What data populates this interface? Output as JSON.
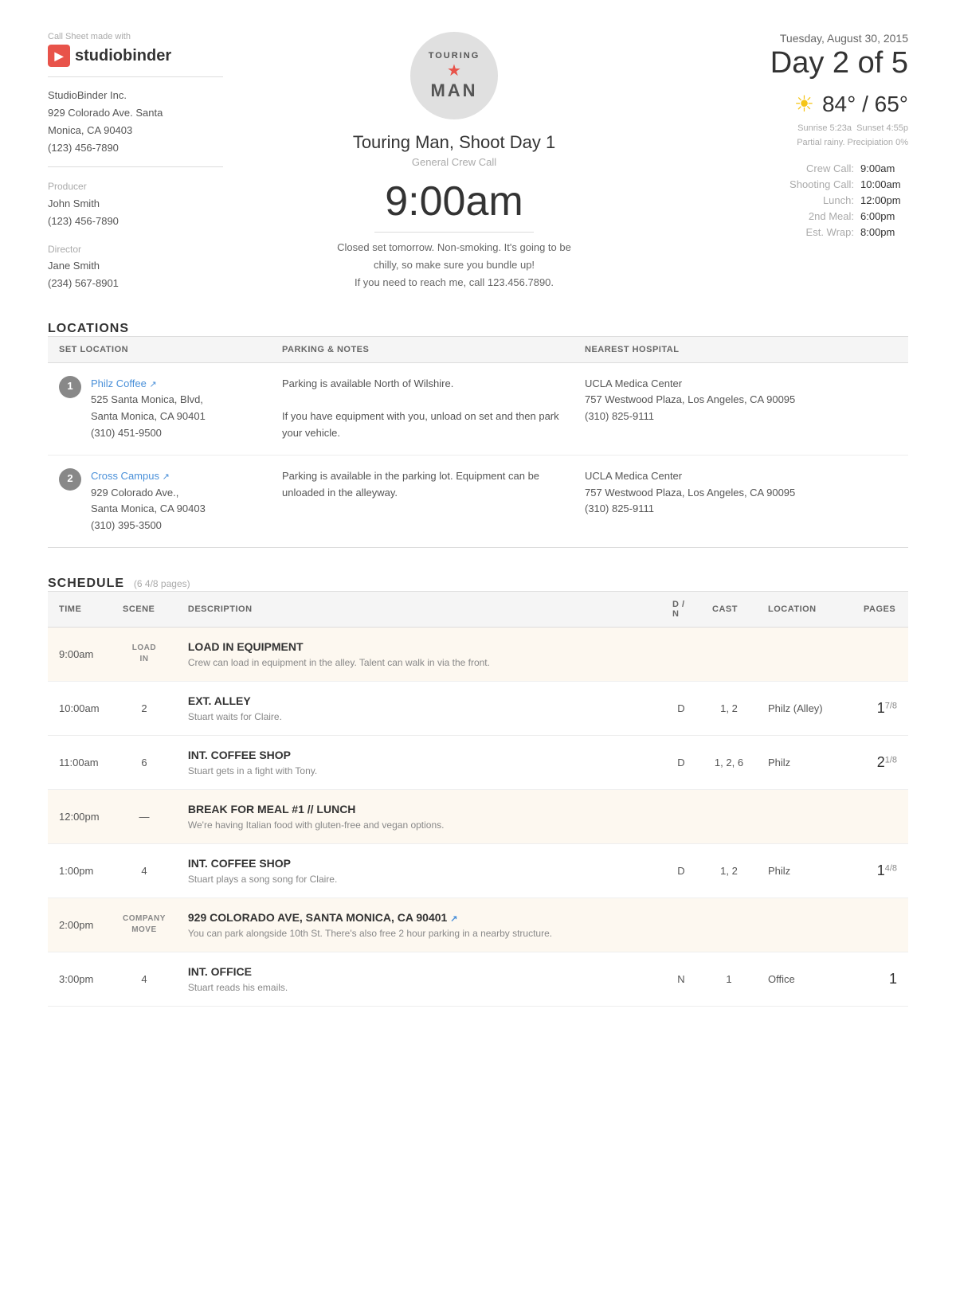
{
  "header": {
    "made_with": "Call Sheet made with",
    "logo_text": "studiobinder",
    "logo_bold": "binder",
    "company": {
      "name": "StudioBinder Inc.",
      "address1": "929 Colorado Ave. Santa",
      "address2": "Monica, CA 90403",
      "phone": "(123) 456-7890"
    },
    "producer_role": "Producer",
    "producer_name": "John Smith",
    "producer_phone": "(123) 456-7890",
    "director_role": "Director",
    "director_name": "Jane Smith",
    "director_phone": "(234) 567-8901"
  },
  "project": {
    "logo_top": "TOURING",
    "logo_star": "★",
    "logo_bottom": "MAN",
    "title": "Touring Man, Shoot Day 1",
    "subtitle": "General Crew Call",
    "time": "9:00am",
    "notes_line1": "Closed set tomorrow. Non-smoking. It's going to be",
    "notes_line2": "chilly, so make sure you bundle up!",
    "notes_line3": "If you need to reach me, call 123.456.7890."
  },
  "date": {
    "heading": "Tuesday, August 30, 2015",
    "day_label": "Day 2 of 5"
  },
  "weather": {
    "temp_high": "84°",
    "temp_low": "65°",
    "sunrise": "Sunrise 5:23a",
    "sunset": "Sunset 4:55p",
    "condition": "Partial rainy. Precipiation 0%"
  },
  "schedule_times": [
    {
      "label": "Crew Call:",
      "value": "9:00am"
    },
    {
      "label": "Shooting Call:",
      "value": "10:00am"
    },
    {
      "label": "Lunch:",
      "value": "12:00pm"
    },
    {
      "label": "2nd Meal:",
      "value": "6:00pm"
    },
    {
      "label": "Est. Wrap:",
      "value": "8:00pm"
    }
  ],
  "locations_section": {
    "title": "LOCATIONS",
    "col_set": "SET LOCATION",
    "col_parking": "PARKING & NOTES",
    "col_hospital": "NEAREST HOSPITAL",
    "rows": [
      {
        "number": "1",
        "name": "Philz Coffee",
        "address1": "525 Santa Monica, Blvd,",
        "address2": "Santa Monica, CA 90401",
        "phone": "(310) 451-9500",
        "parking": "Parking is available North of Wilshire.\n\nIf you have equipment with you, unload on set and then park your vehicle.",
        "hospital_name": "UCLA Medica Center",
        "hospital_address": "757 Westwood Plaza, Los Angeles, CA 90095",
        "hospital_phone": "(310) 825-9111"
      },
      {
        "number": "2",
        "name": "Cross Campus",
        "address1": "929 Colorado Ave.,",
        "address2": "Santa Monica, CA 90403",
        "phone": "(310) 395-3500",
        "parking": "Parking is available in the parking lot. Equipment can be unloaded in the alleyway.",
        "hospital_name": "UCLA Medica Center",
        "hospital_address": "757 Westwood Plaza, Los Angeles, CA 90095",
        "hospital_phone": "(310) 825-9111"
      }
    ]
  },
  "schedule_section": {
    "title": "SCHEDULE",
    "subtitle": "(6 4/8 pages)",
    "col_time": "TIME",
    "col_scene": "SCENE",
    "col_desc": "DESCRIPTION",
    "col_dn": "D / N",
    "col_cast": "CAST",
    "col_location": "LOCATION",
    "col_pages": "PAGES",
    "rows": [
      {
        "time": "9:00am",
        "scene": "LOAD IN",
        "scene_multiline": true,
        "desc_title": "LOAD IN EQUIPMENT",
        "desc_sub": "Crew can load in equipment in the alley. Talent can walk in via the front.",
        "dn": "",
        "cast": "",
        "location": "",
        "pages": "",
        "highlight": true,
        "colspan": true
      },
      {
        "time": "10:00am",
        "scene": "2",
        "desc_title": "EXT. ALLEY",
        "desc_sub": "Stuart waits for Claire.",
        "dn": "D",
        "cast": "1, 2",
        "location": "Philz (Alley)",
        "pages_main": "1",
        "pages_frac": "7/8",
        "highlight": false
      },
      {
        "time": "11:00am",
        "scene": "6",
        "desc_title": "INT. COFFEE SHOP",
        "desc_sub": "Stuart gets in a fight with Tony.",
        "dn": "D",
        "cast": "1, 2, 6",
        "location": "Philz",
        "pages_main": "2",
        "pages_frac": "1/8",
        "highlight": false
      },
      {
        "time": "12:00pm",
        "scene": "—",
        "desc_title": "BREAK FOR MEAL #1 // LUNCH",
        "desc_sub": "We're having Italian food with gluten-free and vegan options.",
        "dn": "",
        "cast": "",
        "location": "",
        "pages": "",
        "highlight": true,
        "colspan": true
      },
      {
        "time": "1:00pm",
        "scene": "4",
        "desc_title": "INT. COFFEE SHOP",
        "desc_sub": "Stuart plays a song song for Claire.",
        "dn": "D",
        "cast": "1, 2",
        "location": "Philz",
        "pages_main": "1",
        "pages_frac": "4/8",
        "highlight": false
      },
      {
        "time": "2:00pm",
        "scene": "COMPANY MOVE",
        "scene_multiline": true,
        "desc_title": "929 COLORADO AVE, SANTA MONICA, CA 90401",
        "desc_has_link": true,
        "desc_sub": "You can park alongside 10th St. There's also free 2 hour parking in a nearby structure.",
        "dn": "",
        "cast": "",
        "location": "",
        "pages": "",
        "highlight": true,
        "colspan": true,
        "is_move": true
      },
      {
        "time": "3:00pm",
        "scene": "4",
        "desc_title": "INT. OFFICE",
        "desc_sub": "Stuart reads his emails.",
        "dn": "N",
        "cast": "1",
        "location": "Office",
        "pages_main": "1",
        "pages_frac": "",
        "highlight": false
      }
    ]
  }
}
